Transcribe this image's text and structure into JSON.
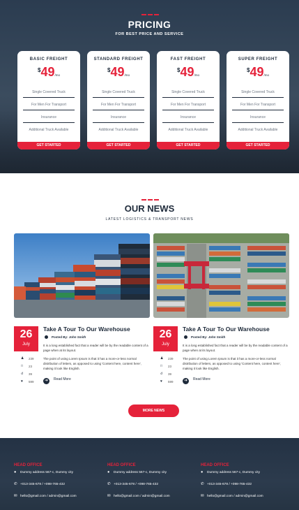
{
  "pricing": {
    "title": "PRICING",
    "subtitle": "FOR BEST PRICE AND SERVICE",
    "plans": [
      {
        "name": "BASIC FREIGHT",
        "currency": "$",
        "amount": "49",
        "period": "/mo",
        "features": [
          "Single Covered Truck",
          "For Men For Transport",
          "Insurance",
          "Additional Truck Available"
        ],
        "cta": "GET STARTED"
      },
      {
        "name": "STANDARD FREIGHT",
        "currency": "$",
        "amount": "49",
        "period": "/mo",
        "features": [
          "Single Covered Truck",
          "For Men For Transport",
          "Insurance",
          "Additional Truck Available"
        ],
        "cta": "GET STARTED"
      },
      {
        "name": "FAST FREIGHT",
        "currency": "$",
        "amount": "49",
        "period": "/mo",
        "features": [
          "Single Covered Truck",
          "For Men For Transport",
          "Insurance",
          "Additional Truck Available"
        ],
        "cta": "GET STARTED"
      },
      {
        "name": "SUPER FREIGHT",
        "currency": "$",
        "amount": "49",
        "period": "/mo",
        "features": [
          "Single Covered Truck",
          "For Men For Transport",
          "Insurance",
          "Additional Truck Available"
        ],
        "cta": "GET STARTED"
      }
    ]
  },
  "news": {
    "title": "OUR NEWS",
    "subtitle": "LATEST LOGISTICS & TRANSPORT NEWS",
    "posts": [
      {
        "day": "26",
        "month": "July",
        "title": "Take A Tour To Our Warehouse",
        "posted_by_label": "Posted By:",
        "author": "John Smith",
        "excerpt": "It is a long established fact that a reader will be by the readable content of a page when at its layout.",
        "excerpt2": "The point of using Lorem Ipsum is that it has a more-or-less normal distribution of letters, as opposed to using 'Content here, content here', making it look like English.",
        "stats": {
          "users": "239",
          "comments": "23",
          "shares": "39",
          "likes": "599"
        },
        "read_more": "Read More"
      },
      {
        "day": "26",
        "month": "July",
        "title": "Take A Tour To Our Warehouse",
        "posted_by_label": "Posted By:",
        "author": "John Smith",
        "excerpt": "It is a long established fact that a reader will be by the readable content of a page when at its layout.",
        "excerpt2": "The point of using Lorem Ipsum is that it has a more-or-less normal distribution of letters, as opposed to using 'Content here, content here', making it look like English.",
        "stats": {
          "users": "239",
          "comments": "23",
          "shares": "39",
          "likes": "599"
        },
        "read_more": "Read More"
      }
    ],
    "more_button": "MORE NEWS"
  },
  "footer": {
    "columns": [
      {
        "heading": "HEAD OFFICE",
        "address": "Dummy address 567-c, Dummy city",
        "phone": "+013-345-678 / +098-765-432",
        "email": "hello@gmail.com / admin@gmail.com"
      },
      {
        "heading": "HEAD OFFICE",
        "address": "Dummy address 567-c, Dummy city",
        "phone": "+013-345-678 / +098-765-432",
        "email": "hello@gmail.com / admin@gmail.com"
      },
      {
        "heading": "HEAD OFFICE",
        "address": "Dummy address 567-c, Dummy city",
        "phone": "+013-345-678 / +098-765-432",
        "email": "hello@gmail.com / admin@gmail.com"
      }
    ]
  },
  "colors": {
    "accent": "#e5223a",
    "navy": "#1e2a3a",
    "dark_bg": "#2b3c50"
  },
  "icons": [
    "user-icon",
    "comment-icon",
    "share-icon",
    "heart-icon",
    "arrow-right-icon",
    "location-pin-icon",
    "phone-icon",
    "mail-icon"
  ]
}
